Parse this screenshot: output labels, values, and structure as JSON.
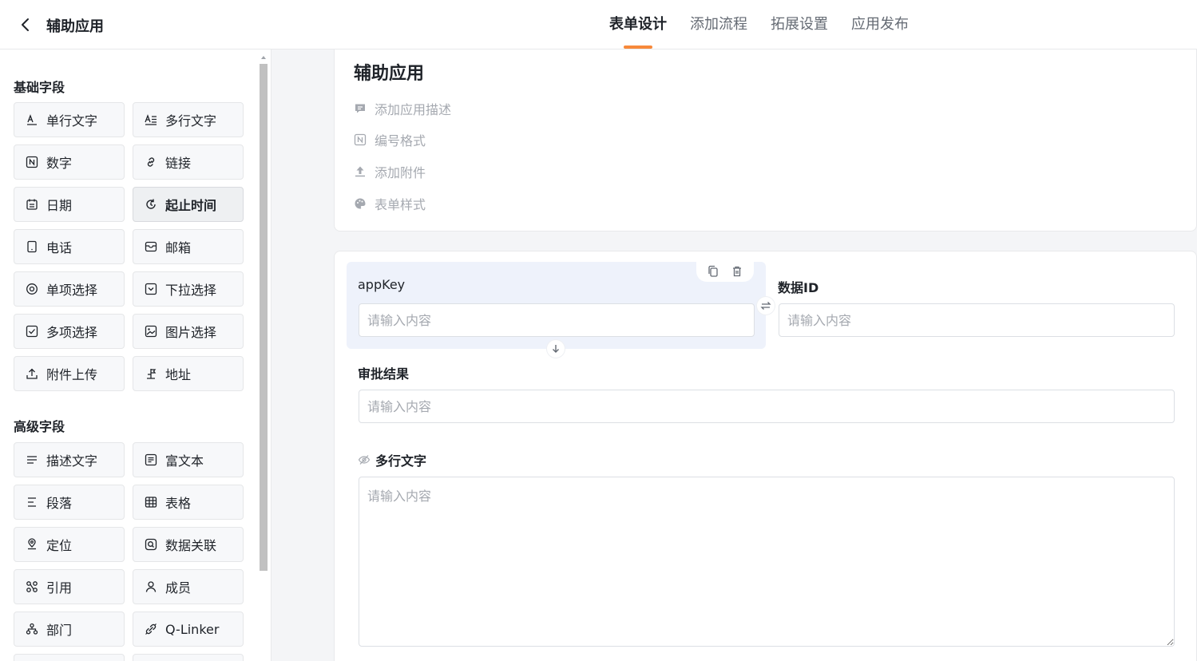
{
  "header": {
    "title": "辅助应用",
    "back_icon": "chevron-left-icon",
    "tabs": [
      {
        "label": "表单设计",
        "active": true
      },
      {
        "label": "添加流程",
        "active": false
      },
      {
        "label": "拓展设置",
        "active": false
      },
      {
        "label": "应用发布",
        "active": false
      }
    ]
  },
  "colors": {
    "accent": "#f7893a",
    "selected_field_bg": "#eef2fb",
    "placeholder": "#a5a9b0"
  },
  "sidebar": {
    "basic_title": "基础字段",
    "basic_fields": [
      {
        "label": "单行文字",
        "icon": "single-line-text-icon"
      },
      {
        "label": "多行文字",
        "icon": "multi-line-text-icon"
      },
      {
        "label": "数字",
        "icon": "number-icon"
      },
      {
        "label": "链接",
        "icon": "link-icon"
      },
      {
        "label": "日期",
        "icon": "calendar-icon"
      },
      {
        "label": "起止时间",
        "icon": "time-range-icon",
        "active": true
      },
      {
        "label": "电话",
        "icon": "phone-icon"
      },
      {
        "label": "邮箱",
        "icon": "mailbox-icon"
      },
      {
        "label": "单项选择",
        "icon": "radio-icon"
      },
      {
        "label": "下拉选择",
        "icon": "dropdown-icon"
      },
      {
        "label": "多项选择",
        "icon": "checkbox-icon"
      },
      {
        "label": "图片选择",
        "icon": "image-icon"
      },
      {
        "label": "附件上传",
        "icon": "upload-icon"
      },
      {
        "label": "地址",
        "icon": "address-icon"
      }
    ],
    "advanced_title": "高级字段",
    "advanced_fields": [
      {
        "label": "描述文字",
        "icon": "description-icon"
      },
      {
        "label": "富文本",
        "icon": "rich-text-icon"
      },
      {
        "label": "段落",
        "icon": "paragraph-icon"
      },
      {
        "label": "表格",
        "icon": "table-icon"
      },
      {
        "label": "定位",
        "icon": "location-icon"
      },
      {
        "label": "数据关联",
        "icon": "data-link-icon"
      },
      {
        "label": "引用",
        "icon": "reference-icon"
      },
      {
        "label": "成员",
        "icon": "member-icon"
      },
      {
        "label": "部门",
        "icon": "department-icon"
      },
      {
        "label": "Q-Linker",
        "icon": "q-linker-icon"
      }
    ]
  },
  "form_info": {
    "name": "辅助应用",
    "items": [
      {
        "label": "添加应用描述",
        "icon": "comment-icon"
      },
      {
        "label": "编号格式",
        "icon": "number-format-icon"
      },
      {
        "label": "添加附件",
        "icon": "upload-arrow-icon"
      },
      {
        "label": "表单样式",
        "icon": "palette-icon"
      }
    ]
  },
  "form": {
    "fields": [
      {
        "label": "appKey",
        "placeholder": "请输入内容",
        "selected": true
      },
      {
        "label": "数据ID",
        "placeholder": "请输入内容"
      },
      {
        "label": "审批结果",
        "placeholder": "请输入内容"
      },
      {
        "label": "多行文字",
        "placeholder": "请输入内容",
        "hidden_icon": "eye-off-icon"
      }
    ],
    "tools": [
      "copy-icon",
      "delete-icon"
    ]
  }
}
